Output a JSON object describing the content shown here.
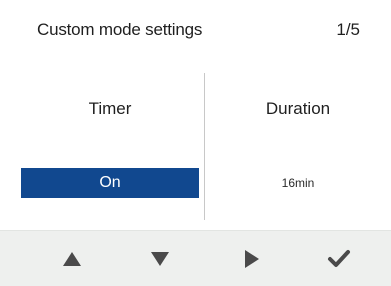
{
  "header": {
    "title": "Custom mode settings",
    "page_indicator": "1/5"
  },
  "columns": [
    {
      "label": "Timer",
      "value": "On",
      "selected": true
    },
    {
      "label": "Duration",
      "value": "16min",
      "selected": false
    }
  ],
  "footer": {
    "buttons": [
      {
        "icon": "up-arrow-icon"
      },
      {
        "icon": "down-arrow-icon"
      },
      {
        "icon": "right-arrow-icon"
      },
      {
        "icon": "checkmark-icon"
      }
    ]
  },
  "colors": {
    "selection": "#11488f",
    "footer_bg": "#eef0ee",
    "icon": "#4a4a4a"
  }
}
